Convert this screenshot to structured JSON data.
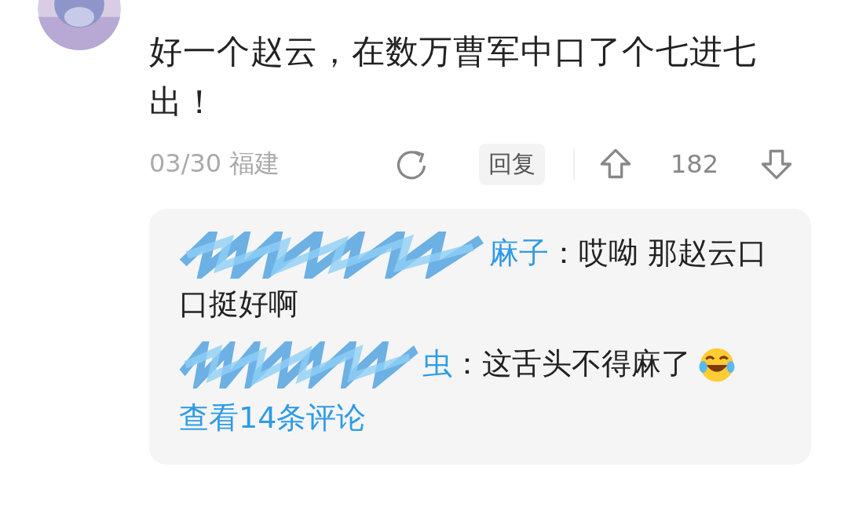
{
  "comment": {
    "text": "好一个赵云，在数万曹军中口了个七进七出！",
    "date": "03/30",
    "location": "福建",
    "reply_button": "回复",
    "likes": "182"
  },
  "replies": [
    {
      "author": "麻子",
      "text": "：哎呦 那赵云口口挺好啊",
      "redacted": true,
      "emoji": false
    },
    {
      "author": "虫",
      "text": "：这舌头不得麻了",
      "redacted": true,
      "emoji": true
    }
  ],
  "more_link": "查看14条评论"
}
